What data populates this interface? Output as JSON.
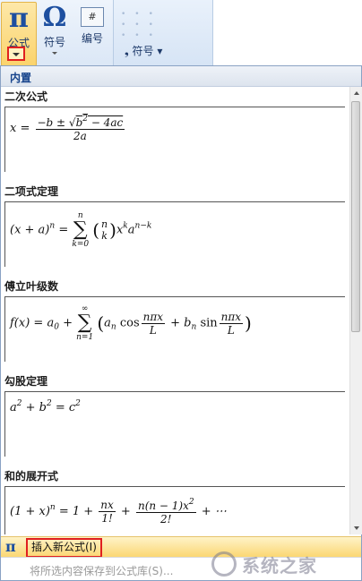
{
  "ribbon": {
    "formula_label": "公式",
    "formula_icon": "π",
    "symbol_label": "符号",
    "symbol_icon": "Ω",
    "number_label": "编号",
    "number_icon": "#",
    "symbols_group_label": "符号"
  },
  "gallery": {
    "header": "内置",
    "items": [
      {
        "title": "二次公式"
      },
      {
        "title": "二项式定理"
      },
      {
        "title": "傅立叶级数"
      },
      {
        "title": "勾股定理"
      },
      {
        "title": "和的展开式"
      }
    ]
  },
  "footer": {
    "insert_label": "插入新公式(I)",
    "save_label": "将所选内容保存到公式库(S)..."
  },
  "watermark": {
    "text": "系统之家"
  },
  "colors": {
    "highlight": "#e02020",
    "accent": "#15428b"
  }
}
